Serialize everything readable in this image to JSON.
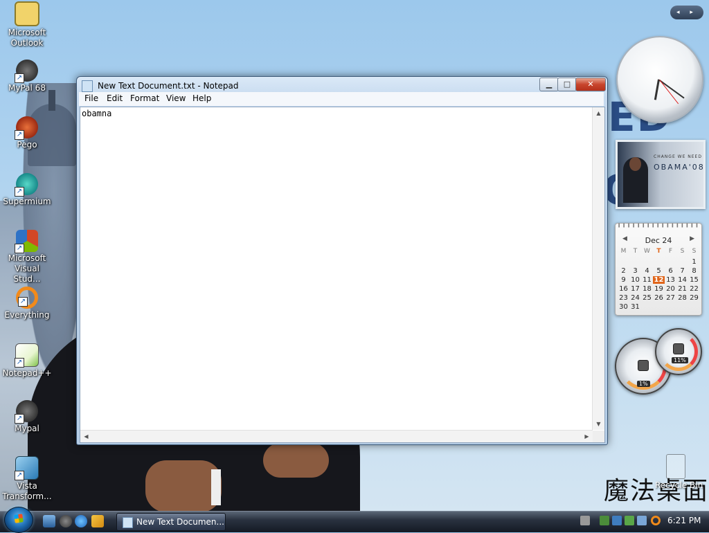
{
  "desktop": {
    "icons": [
      {
        "label": "Microsoft Outlook"
      },
      {
        "label": "MyPal 68"
      },
      {
        "label": "Pego"
      },
      {
        "label": "Supermium"
      },
      {
        "label": "Microsoft Visual Stud..."
      },
      {
        "label": "Everything"
      },
      {
        "label": "Notepad++"
      },
      {
        "label": "Mypal"
      },
      {
        "label": "Vista Transform..."
      }
    ],
    "recycle_label": "Recycle Bin",
    "wallpaper_text_1": "ED",
    "wallpaper_text_2": "O",
    "logo_text": "魔法桌面"
  },
  "notepad": {
    "title": "New Text Document.txt - Notepad",
    "menu": [
      "File",
      "Edit",
      "Format",
      "View",
      "Help"
    ],
    "content": "obamna",
    "buttons": {
      "minimize": "▁",
      "maximize": "□",
      "close": "✕"
    }
  },
  "sidebar": {
    "nav": "◂ ▸",
    "photo": {
      "slogan": "CHANGE WE NEED",
      "name": "OBAMA'08"
    },
    "calendar": {
      "month": "Dec 24",
      "dow": [
        "M",
        "T",
        "W",
        "T",
        "F",
        "S",
        "S"
      ],
      "today_dow_index": 3,
      "weeks": [
        [
          "",
          "",
          "",
          "",
          "",
          "",
          "1"
        ],
        [
          "2",
          "3",
          "4",
          "5",
          "6",
          "7",
          "8"
        ],
        [
          "9",
          "10",
          "11",
          "12",
          "13",
          "14",
          "15"
        ],
        [
          "16",
          "17",
          "18",
          "19",
          "20",
          "21",
          "22"
        ],
        [
          "23",
          "24",
          "25",
          "26",
          "27",
          "28",
          "29"
        ],
        [
          "30",
          "31",
          "",
          "",
          "",
          "",
          ""
        ]
      ],
      "today": "12"
    },
    "meters": {
      "cpu": "1%",
      "memory": "11%"
    }
  },
  "taskbar": {
    "task_label": "New Text Documen...",
    "time": "6:21 PM"
  },
  "colors": {
    "accent": "#e0651a",
    "title_bar": "#c6daef",
    "taskbar": "#1f2733"
  }
}
